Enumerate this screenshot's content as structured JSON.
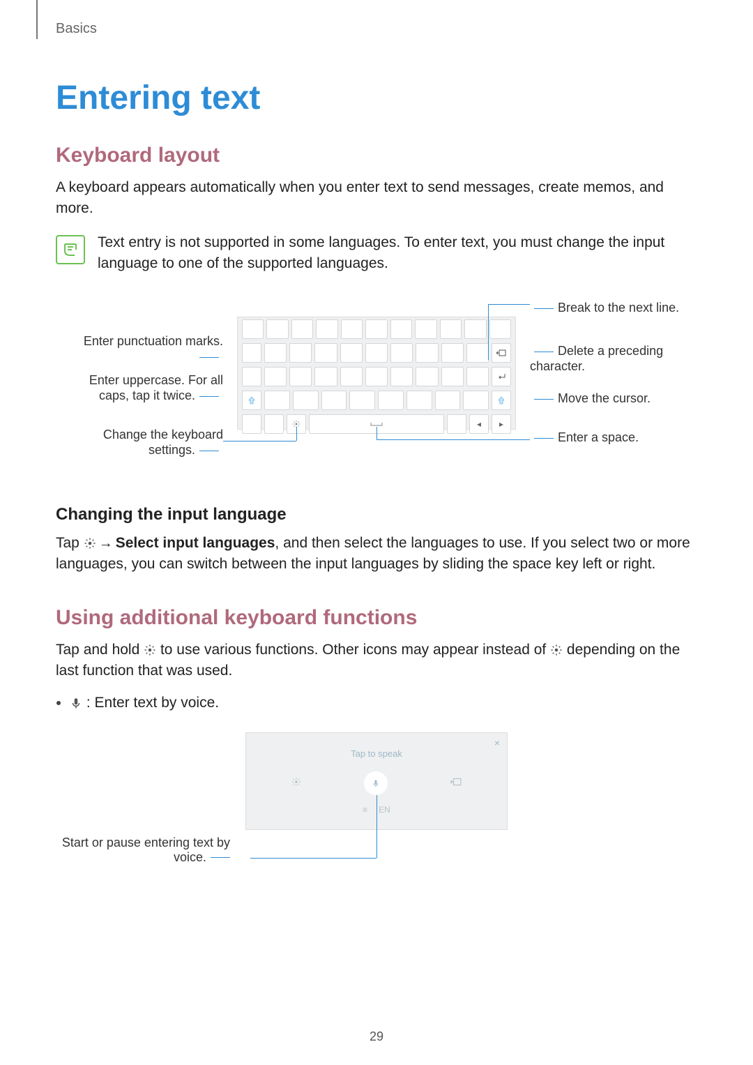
{
  "breadcrumb": "Basics",
  "title": "Entering text",
  "section1": {
    "heading": "Keyboard layout",
    "intro": "A keyboard appears automatically when you enter text to send messages, create memos, and more.",
    "note": "Text entry is not supported in some languages. To enter text, you must change the input language to one of the supported languages."
  },
  "kbd_callouts": {
    "left": {
      "punct": "Enter punctuation marks.",
      "shift": "Enter uppercase. For all caps, tap it twice.",
      "settings": "Change the keyboard settings."
    },
    "right": {
      "break": "Break to the next line.",
      "delete": "Delete a preceding character.",
      "cursor": "Move the cursor.",
      "space": "Enter a space."
    }
  },
  "section1b": {
    "subheading": "Changing the input language",
    "p_before": "Tap ",
    "p_action": "Select input languages",
    "p_after": ", and then select the languages to use. If you select two or more languages, you can switch between the input languages by sliding the space key left or right."
  },
  "section2": {
    "heading": "Using additional keyboard functions",
    "p_before": "Tap and hold ",
    "p_mid": " to use various functions. Other icons may appear instead of ",
    "p_after": " depending on the last function that was used."
  },
  "bullets": {
    "voice": ": Enter text by voice."
  },
  "voice_diagram": {
    "callout": "Start or pause entering text by voice.",
    "tap_to_speak": "Tap to speak",
    "lang_menu": "≡",
    "lang_en": "EN"
  },
  "page_number": "29"
}
